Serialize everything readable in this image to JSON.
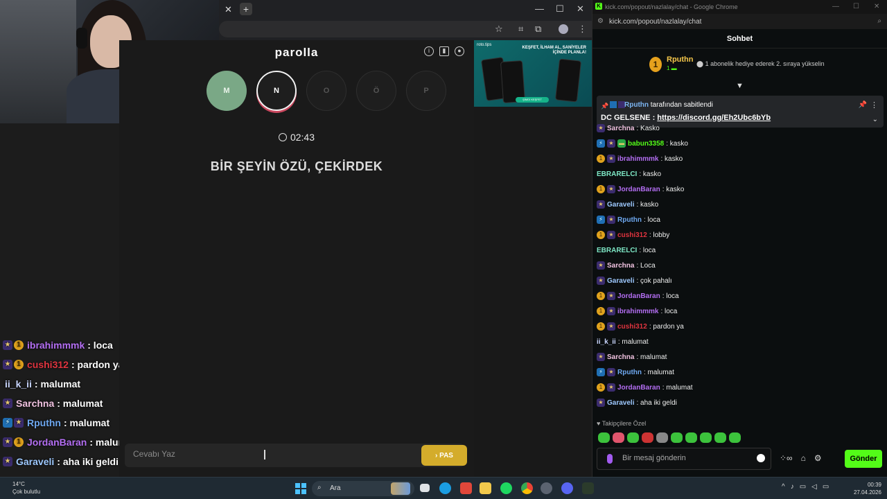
{
  "overlay_chat": [
    {
      "badges": [
        "star",
        "gold"
      ],
      "user": "ibrahimmmk",
      "user_color": "#b36ef2",
      "message": ": loca"
    },
    {
      "badges": [
        "star",
        "gold"
      ],
      "user": "cushi312",
      "user_color": "#e0343f",
      "message": ": pardon ya"
    },
    {
      "badges": [],
      "user": "ii_k_ii",
      "user_color": "#c9d6ff",
      "message": ": malumat"
    },
    {
      "badges": [
        "star"
      ],
      "user": "Sarchna",
      "user_color": "#f0c2e0",
      "message": ": malumat"
    },
    {
      "badges": [
        "blue",
        "star"
      ],
      "user": "Rputhn",
      "user_color": "#6ea8f0",
      "message": ": malumat"
    },
    {
      "badges": [
        "star",
        "gold"
      ],
      "user": "JordanBaran",
      "user_color": "#b36ef2",
      "message": ": malumat"
    },
    {
      "badges": [
        "star"
      ],
      "user": "Garaveli",
      "user_color": "#9ec9ff",
      "message": ": aha iki geldi"
    }
  ],
  "game": {
    "title": "parolla",
    "letters": [
      {
        "label": "M",
        "state": "done"
      },
      {
        "label": "N",
        "state": "active"
      },
      {
        "label": "O",
        "state": "empty"
      },
      {
        "label": "Ö",
        "state": "empty"
      },
      {
        "label": "P",
        "state": "empty"
      }
    ],
    "timer": "02:43",
    "question": "BİR ŞEYİN ÖZÜ, ÇEKİRDEK",
    "answer_placeholder": "Cevabı Yaz",
    "pass_label": "PAS"
  },
  "ad": {
    "logo": "roto.tips",
    "headline": "KEŞFET, İLHAM AL, SANİYELER İÇİNDE PLANLA!",
    "cta": "ŞİMDİ KEŞFET"
  },
  "kick": {
    "window_title": "kick.com/popout/nazlalay/chat - Google Chrome",
    "url": "kick.com/popout/nazlalay/chat",
    "header": "Sohbet",
    "gift": {
      "rank": "1",
      "user": "Rputhn",
      "count": "1",
      "message": "1 abonelik hediye ederek 2. sıraya yükselin"
    },
    "pinned": {
      "by_user": "Rputhn",
      "by_text": " tarafından sabitlendi",
      "text_prefix": "DC GELSENE : ",
      "link": "https://discord.gg/Eh2Ubc6bYb"
    },
    "messages": [
      {
        "badges": [
          "star"
        ],
        "user": "Sarchna",
        "color": "#f0c2e0",
        "msg": ": Kasko"
      },
      {
        "badges": [
          "blue",
          "star",
          "green"
        ],
        "user": "babun3358",
        "color": "#53fc18",
        "msg": ": kasko"
      },
      {
        "badges": [
          "gold",
          "star"
        ],
        "user": "ibrahimmmk",
        "color": "#b36ef2",
        "msg": ": kasko"
      },
      {
        "badges": [],
        "user": "EBRARELCI",
        "color": "#7ee8c6",
        "msg": ": kasko"
      },
      {
        "badges": [
          "gold",
          "star"
        ],
        "user": "JordanBaran",
        "color": "#b36ef2",
        "msg": ": kasko"
      },
      {
        "badges": [
          "star"
        ],
        "user": "Garaveli",
        "color": "#9ec9ff",
        "msg": ": kasko"
      },
      {
        "badges": [
          "blue",
          "star"
        ],
        "user": "Rputhn",
        "color": "#6ea8f0",
        "msg": ": loca"
      },
      {
        "badges": [
          "gold",
          "star"
        ],
        "user": "cushi312",
        "color": "#e0343f",
        "msg": ": lobby"
      },
      {
        "badges": [],
        "user": "EBRARELCI",
        "color": "#7ee8c6",
        "msg": ": loca"
      },
      {
        "badges": [
          "star"
        ],
        "user": "Sarchna",
        "color": "#f0c2e0",
        "msg": ": Loca"
      },
      {
        "badges": [
          "star"
        ],
        "user": "Garaveli",
        "color": "#9ec9ff",
        "msg": ": çok pahalı"
      },
      {
        "badges": [
          "gold",
          "star"
        ],
        "user": "JordanBaran",
        "color": "#b36ef2",
        "msg": ": loca"
      },
      {
        "badges": [
          "gold",
          "star"
        ],
        "user": "ibrahimmmk",
        "color": "#b36ef2",
        "msg": ": loca"
      },
      {
        "badges": [
          "gold",
          "star"
        ],
        "user": "cushi312",
        "color": "#e0343f",
        "msg": ": pardon ya"
      },
      {
        "badges": [],
        "user": "ii_k_ii",
        "color": "#c9d6ff",
        "msg": ": malumat"
      },
      {
        "badges": [
          "star"
        ],
        "user": "Sarchna",
        "color": "#f0c2e0",
        "msg": ": malumat"
      },
      {
        "badges": [
          "blue",
          "star"
        ],
        "user": "Rputhn",
        "color": "#6ea8f0",
        "msg": ": malumat"
      },
      {
        "badges": [
          "gold",
          "star"
        ],
        "user": "JordanBaran",
        "color": "#b36ef2",
        "msg": ": malumat"
      },
      {
        "badges": [
          "star"
        ],
        "user": "Garaveli",
        "color": "#9ec9ff",
        "msg": ": aha iki geldi"
      }
    ],
    "followers_label": "Takipçilere Özel",
    "input_placeholder": "Bir mesaj gönderin",
    "send_label": "Gönder"
  },
  "taskbar": {
    "weather_temp": "14°C",
    "weather_desc": "Çok bulutlu",
    "search_label": "Ara",
    "time": "00:39",
    "date": "27.04.2026"
  },
  "colors": {
    "kick_green": "#53fc18",
    "pass_button": "#d4ac2b",
    "done_letter": "#7aa886",
    "active_ring": "#c9475e"
  }
}
